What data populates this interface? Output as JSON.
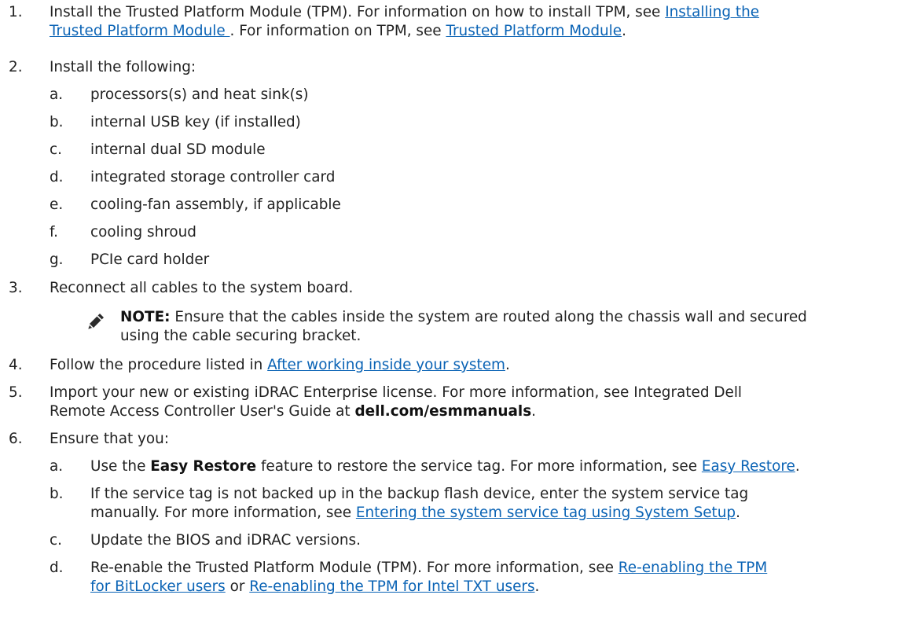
{
  "steps": {
    "s1": {
      "num": "1.",
      "line1_pre": "Install the Trusted Platform Module (TPM). For information on how to install TPM, see ",
      "link1_part1": "Installing the",
      "link1_part2": "Trusted Platform Module ",
      "line2_mid": ". For information on TPM, see ",
      "link2": "Trusted Platform Module",
      "line2_end": "."
    },
    "s2": {
      "num": "2.",
      "text": "Install the following:",
      "items": [
        {
          "letter": "a.",
          "text": "processors(s) and heat sink(s)"
        },
        {
          "letter": "b.",
          "text": "internal USB key (if installed)"
        },
        {
          "letter": "c.",
          "text": "internal dual SD module"
        },
        {
          "letter": "d.",
          "text": "integrated storage controller card"
        },
        {
          "letter": "e.",
          "text": "cooling-fan assembly, if applicable"
        },
        {
          "letter": "f.",
          "text": "cooling shroud"
        },
        {
          "letter": "g.",
          "text": "PCIe card holder"
        }
      ]
    },
    "s3": {
      "num": "3.",
      "text": "Reconnect all cables to the system board.",
      "note_label": "NOTE:",
      "note_line1": " Ensure that the cables inside the system are routed along the chassis wall and secured",
      "note_line2": "using the cable securing bracket."
    },
    "s4": {
      "num": "4.",
      "pre": "Follow the procedure listed in ",
      "link": "After working inside your system",
      "end": "."
    },
    "s5": {
      "num": "5.",
      "line1": "Import your new or existing iDRAC Enterprise license. For more information, see Integrated Dell",
      "line2_pre": "Remote Access Controller User's Guide at ",
      "bold": "dell.com/esmmanuals",
      "end": "."
    },
    "s6": {
      "num": "6.",
      "text": "Ensure that you:",
      "a": {
        "letter": "a.",
        "pre": "Use the ",
        "bold": "Easy Restore",
        "mid": " feature to restore the service tag. For more information, see ",
        "link": "Easy Restore",
        "end": "."
      },
      "b": {
        "letter": "b.",
        "line1": "If the service tag is not backed up in the backup flash device, enter the system service tag",
        "line2_pre": "manually. For more information, see ",
        "link": "Entering the system service tag using System Setup",
        "end": "."
      },
      "c": {
        "letter": "c.",
        "text": "Update the BIOS and iDRAC versions."
      },
      "d": {
        "letter": "d.",
        "line1_pre": "Re-enable the Trusted Platform Module (TPM). For more information, see ",
        "link1_part1": "Re-enabling the TPM",
        "link1_part2": "for BitLocker users",
        "mid": " or ",
        "link2": "Re-enabling the TPM for Intel TXT users",
        "end": "."
      }
    }
  }
}
